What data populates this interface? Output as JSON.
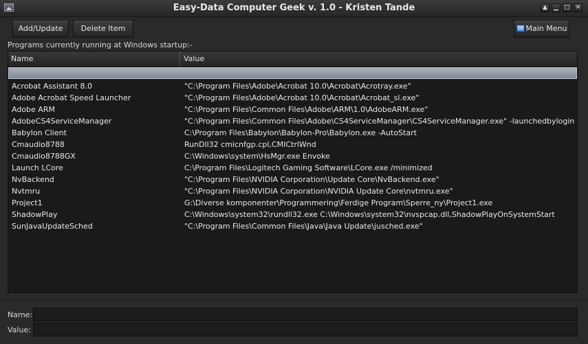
{
  "window": {
    "title": "Easy-Data Computer Geek v. 1.0 - Kristen Tande",
    "controls": [
      "▲",
      "▁",
      "□",
      "✕"
    ]
  },
  "toolbar": {
    "add_update_label": "Add/Update",
    "delete_label": "Delete Item",
    "main_menu_label": "Main Menu"
  },
  "section": {
    "label": "Programs currently running at Windows startup:-"
  },
  "table": {
    "columns": [
      "Name",
      "Value"
    ],
    "rows": [
      {
        "name": "Acrobat Assistant 8.0",
        "value": "\"C:\\Program Files\\Adobe\\Acrobat 10.0\\Acrobat\\Acrotray.exe\""
      },
      {
        "name": "Adobe Acrobat Speed Launcher",
        "value": "\"C:\\Program Files\\Adobe\\Acrobat 10.0\\Acrobat\\Acrobat_sl.exe\""
      },
      {
        "name": "Adobe ARM",
        "value": "\"C:\\Program Files\\Common Files\\Adobe\\ARM\\1.0\\AdobeARM.exe\""
      },
      {
        "name": "AdobeCS4ServiceManager",
        "value": "\"C:\\Program Files\\Common Files\\Adobe\\CS4ServiceManager\\CS4ServiceManager.exe\" -launchedbylogin"
      },
      {
        "name": "Babylon Client",
        "value": "C:\\Program Files\\Babylon\\Babylon-Pro\\Babylon.exe -AutoStart"
      },
      {
        "name": "Cmaudio8788",
        "value": "RunDll32 cmicnfgp.cpl,CMICtrlWnd"
      },
      {
        "name": "Cmaudio8788GX",
        "value": "C:\\Windows\\system\\HsMgr.exe Envoke"
      },
      {
        "name": "Launch LCore",
        "value": "C:\\Program Files\\Logitech Gaming Software\\LCore.exe /minimized"
      },
      {
        "name": "NvBackend",
        "value": "\"C:\\Program Files\\NVIDIA Corporation\\Update Core\\NvBackend.exe\""
      },
      {
        "name": "Nvtmru",
        "value": "\"C:\\Program Files\\NVIDIA Corporation\\NVIDIA Update Core\\nvtmru.exe\""
      },
      {
        "name": "Project1",
        "value": "G:\\Diverse komponenter\\Programmering\\Ferdige Program\\Sperre_ny\\Project1.exe"
      },
      {
        "name": "ShadowPlay",
        "value": "C:\\Windows\\system32\\rundll32.exe C:\\Windows\\system32\\nvspcap.dll,ShadowPlayOnSystemStart"
      },
      {
        "name": "SunJavaUpdateSched",
        "value": "\"C:\\Program Files\\Common Files\\Java\\Java Update\\jusched.exe\""
      }
    ]
  },
  "form": {
    "name_label": "Name:",
    "name_value": "",
    "value_label": "Value:",
    "value_value": ""
  }
}
